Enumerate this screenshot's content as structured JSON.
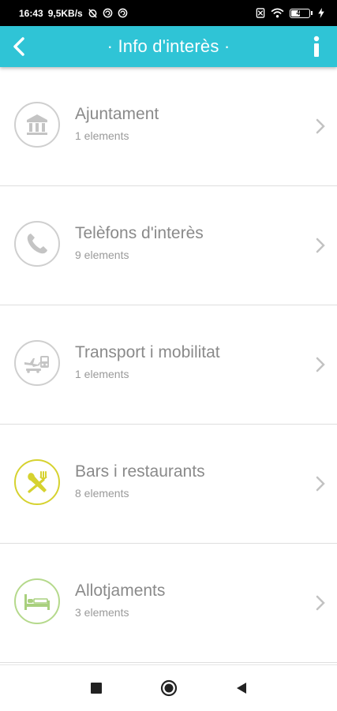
{
  "status_bar": {
    "time": "16:43",
    "speed": "9,5KB/s",
    "battery": "46",
    "battery_level": 0.46
  },
  "app_bar": {
    "title": "· Info d'interès ·",
    "accent": "#2fc4d6"
  },
  "items": [
    {
      "title": "Ajuntament",
      "subtitle": "1 elements",
      "icon": "town-hall-icon",
      "color": "#c8c8c8"
    },
    {
      "title": "Telèfons d'interès",
      "subtitle": "9 elements",
      "icon": "phone-icon",
      "color": "#c8c8c8"
    },
    {
      "title": "Transport i mobilitat",
      "subtitle": "1 elements",
      "icon": "transport-icon",
      "color": "#c8c8c8"
    },
    {
      "title": "Bars i restaurants",
      "subtitle": "8 elements",
      "icon": "restaurant-icon",
      "color": "#d6d22f"
    },
    {
      "title": "Allotjaments",
      "subtitle": "3 elements",
      "icon": "bed-icon",
      "color": "#b5d98c"
    }
  ]
}
